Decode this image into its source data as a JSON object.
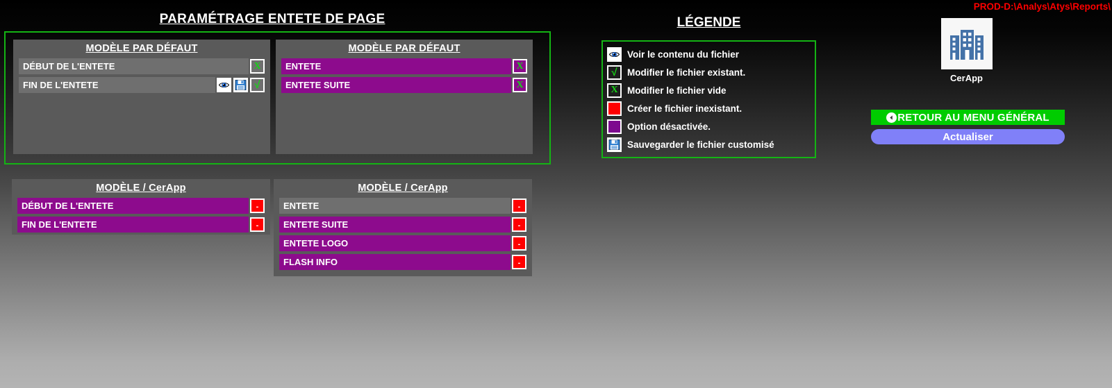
{
  "page": {
    "title": "PARAMÉTRAGE ENTETE DE PAGE",
    "legend_title": "LÉGENDE",
    "env_path": "PROD-D:\\Analys\\Atys\\Reports\\"
  },
  "colors": {
    "frame_green": "#14b414",
    "row_purple": "#8d0b8d",
    "row_gray": "#6f6f6f",
    "panel_gray": "#5a5a5a",
    "red": "#ff0000",
    "green_button": "#00cc00",
    "refresh_button": "#8080f8",
    "path_red": "#ff0000",
    "icon_blue": "#4472a8"
  },
  "default_frame": {
    "panels": [
      {
        "title": "MODÈLE PAR DÉFAUT",
        "rows": [
          {
            "label": "DÉBUT DE L'ENTETE",
            "style": "gray",
            "actions": [
              {
                "icon": "x-empty-file",
                "glyph": "X",
                "variant": "x-gray"
              }
            ]
          },
          {
            "label": "FIN DE L'ENTETE",
            "style": "gray",
            "actions": [
              {
                "icon": "eye-view-file",
                "glyph": "",
                "variant": "icon"
              },
              {
                "icon": "floppy-save-file",
                "glyph": "",
                "variant": "icon"
              },
              {
                "icon": "check-edit-file",
                "glyph": "√",
                "variant": "check"
              }
            ]
          }
        ]
      },
      {
        "title": "MODÈLE PAR DÉFAUT",
        "rows": [
          {
            "label": "ENTETE",
            "style": "purple",
            "actions": [
              {
                "icon": "x-empty-file",
                "glyph": "X",
                "variant": "x-purple"
              }
            ]
          },
          {
            "label": "ENTETE SUITE",
            "style": "purple",
            "actions": [
              {
                "icon": "x-empty-file",
                "glyph": "X",
                "variant": "x-purple"
              }
            ]
          }
        ]
      }
    ]
  },
  "lower_panels": [
    {
      "title": "MODÈLE / CerApp",
      "rows": [
        {
          "label": "DÉBUT DE L'ENTETE",
          "style": "purple",
          "actions": [
            {
              "icon": "create-missing-file",
              "glyph": "-",
              "variant": "red"
            }
          ]
        },
        {
          "label": "FIN DE L'ENTETE",
          "style": "purple",
          "actions": [
            {
              "icon": "create-missing-file",
              "glyph": "-",
              "variant": "red"
            }
          ]
        }
      ]
    },
    {
      "title": "MODÈLE / CerApp",
      "rows": [
        {
          "label": "ENTETE",
          "style": "gray",
          "actions": [
            {
              "icon": "create-missing-file",
              "glyph": "-",
              "variant": "red"
            }
          ]
        },
        {
          "label": "ENTETE SUITE",
          "style": "purple",
          "actions": [
            {
              "icon": "create-missing-file",
              "glyph": "-",
              "variant": "red"
            }
          ]
        },
        {
          "label": "ENTETE LOGO",
          "style": "purple",
          "actions": [
            {
              "icon": "create-missing-file",
              "glyph": "-",
              "variant": "red"
            }
          ]
        },
        {
          "label": "FLASH INFO",
          "style": "purple",
          "actions": [
            {
              "icon": "create-missing-file",
              "glyph": "-",
              "variant": "red"
            }
          ]
        }
      ]
    }
  ],
  "legend": {
    "items": [
      {
        "icon": "eye-view-file",
        "swatch": "sw-eye",
        "glyph": "",
        "text": "Voir le contenu du fichier"
      },
      {
        "icon": "check-edit-file",
        "swatch": "sw-check",
        "glyph": "√",
        "text": "Modifier le fichier existant."
      },
      {
        "icon": "x-empty-file",
        "swatch": "sw-x",
        "glyph": "X",
        "text": "Modifier le fichier vide"
      },
      {
        "icon": "create-missing-file",
        "swatch": "sw-red",
        "glyph": "",
        "text": "Créer le fichier inexistant."
      },
      {
        "icon": "option-disabled",
        "swatch": "sw-purple",
        "glyph": "",
        "text": "Option désactivée."
      },
      {
        "icon": "floppy-save-file",
        "swatch": "sw-save",
        "glyph": "",
        "text": "Sauvegarder le fichier customisé"
      }
    ]
  },
  "right_column": {
    "app_shortcut": {
      "label": "CerApp",
      "icon": "office-buildings-icon"
    },
    "menu_button": {
      "label": "RETOUR AU MENU GÉNÉRAL",
      "icon": "back-arrow-icon"
    },
    "refresh_button": {
      "label": "Actualiser"
    }
  }
}
